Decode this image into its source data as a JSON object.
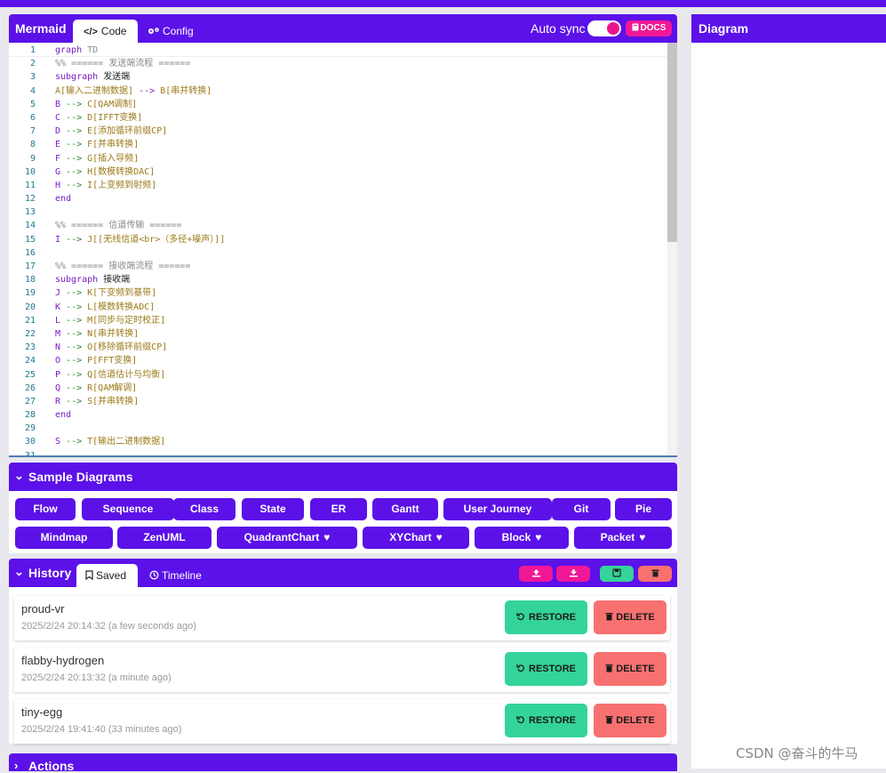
{
  "editor": {
    "title": "Mermaid",
    "tabs": [
      "Code",
      "Config"
    ],
    "code_tab_icon": "</>",
    "config_tab_icon": "gears-icon",
    "auto_sync_label": "Auto sync",
    "auto_sync_enabled": true,
    "docs_label": "DOCS",
    "lines": [
      [
        {
          "t": "graph ",
          "c": "kw"
        },
        {
          "t": "TD",
          "c": "cm"
        }
      ],
      [
        {
          "t": "%% ====== 发送端流程 ======",
          "c": "cm"
        }
      ],
      [
        {
          "t": "subgraph ",
          "c": "kw"
        },
        {
          "t": "发送端",
          "c": "tx"
        }
      ],
      [
        {
          "t": "A[输入二进制数据] ",
          "c": "br"
        },
        {
          "t": "--> ",
          "c": "kw"
        },
        {
          "t": "B[串并转换]",
          "c": "br"
        }
      ],
      [
        {
          "t": "B ",
          "c": "kw"
        },
        {
          "t": "--> ",
          "c": "ar"
        },
        {
          "t": "C[QAM调制]",
          "c": "br"
        }
      ],
      [
        {
          "t": "C ",
          "c": "kw"
        },
        {
          "t": "--> ",
          "c": "ar"
        },
        {
          "t": "D[IFFT变换]",
          "c": "br"
        }
      ],
      [
        {
          "t": "D ",
          "c": "kw"
        },
        {
          "t": "--> ",
          "c": "ar"
        },
        {
          "t": "E[添加循环前缀CP]",
          "c": "br"
        }
      ],
      [
        {
          "t": "E ",
          "c": "kw"
        },
        {
          "t": "--> ",
          "c": "ar"
        },
        {
          "t": "F[并串转换]",
          "c": "br"
        }
      ],
      [
        {
          "t": "F ",
          "c": "kw"
        },
        {
          "t": "--> ",
          "c": "ar"
        },
        {
          "t": "G[插入导频]",
          "c": "br"
        }
      ],
      [
        {
          "t": "G ",
          "c": "kw"
        },
        {
          "t": "--> ",
          "c": "ar"
        },
        {
          "t": "H[数模转换DAC]",
          "c": "br"
        }
      ],
      [
        {
          "t": "H ",
          "c": "kw"
        },
        {
          "t": "--> ",
          "c": "ar"
        },
        {
          "t": "I[上变频到射频]",
          "c": "br"
        }
      ],
      [
        {
          "t": "end",
          "c": "kw"
        }
      ],
      [],
      [
        {
          "t": "%% ====== 信道传输 ======",
          "c": "cm"
        }
      ],
      [
        {
          "t": "I ",
          "c": "kw"
        },
        {
          "t": "--> ",
          "c": "ar"
        },
        {
          "t": "J[[无线信道<br>（多径+噪声）]]",
          "c": "br"
        }
      ],
      [],
      [
        {
          "t": "%% ====== 接收端流程 ======",
          "c": "cm"
        }
      ],
      [
        {
          "t": "subgraph ",
          "c": "kw"
        },
        {
          "t": "接收端",
          "c": "tx"
        }
      ],
      [
        {
          "t": "J ",
          "c": "kw"
        },
        {
          "t": "--> ",
          "c": "ar"
        },
        {
          "t": "K[下变频到基带]",
          "c": "br"
        }
      ],
      [
        {
          "t": "K ",
          "c": "kw"
        },
        {
          "t": "--> ",
          "c": "ar"
        },
        {
          "t": "L[模数转换ADC]",
          "c": "br"
        }
      ],
      [
        {
          "t": "L ",
          "c": "kw"
        },
        {
          "t": "--> ",
          "c": "ar"
        },
        {
          "t": "M[同步与定时校正]",
          "c": "br"
        }
      ],
      [
        {
          "t": "M ",
          "c": "kw"
        },
        {
          "t": "--> ",
          "c": "ar"
        },
        {
          "t": "N[串并转换]",
          "c": "br"
        }
      ],
      [
        {
          "t": "N ",
          "c": "kw"
        },
        {
          "t": "--> ",
          "c": "ar"
        },
        {
          "t": "O[移除循环前缀CP]",
          "c": "br"
        }
      ],
      [
        {
          "t": "O ",
          "c": "kw"
        },
        {
          "t": "--> ",
          "c": "ar"
        },
        {
          "t": "P[FFT变换]",
          "c": "br"
        }
      ],
      [
        {
          "t": "P ",
          "c": "kw"
        },
        {
          "t": "--> ",
          "c": "ar"
        },
        {
          "t": "Q[信道估计与均衡]",
          "c": "br"
        }
      ],
      [
        {
          "t": "Q ",
          "c": "kw"
        },
        {
          "t": "--> ",
          "c": "ar"
        },
        {
          "t": "R[QAM解调]",
          "c": "br"
        }
      ],
      [
        {
          "t": "R ",
          "c": "kw"
        },
        {
          "t": "--> ",
          "c": "ar"
        },
        {
          "t": "S[并串转换]",
          "c": "br"
        }
      ],
      [
        {
          "t": "end",
          "c": "kw"
        }
      ],
      [],
      [
        {
          "t": "S ",
          "c": "kw"
        },
        {
          "t": "--> ",
          "c": "ar"
        },
        {
          "t": "T[输出二进制数据]",
          "c": "br"
        }
      ],
      []
    ]
  },
  "samples": {
    "title": "Sample Diagrams",
    "heart": "♥",
    "row1": [
      "Flow",
      "Sequence",
      "Class",
      "State",
      "ER",
      "Gantt",
      "User Journey",
      "Git",
      "Pie"
    ],
    "row2": [
      "Mindmap",
      "ZenUML",
      "QuadrantChart",
      "XYChart",
      "Block",
      "Packet"
    ],
    "row2_hearts": [
      false,
      false,
      true,
      true,
      true,
      true
    ]
  },
  "history": {
    "title": "History",
    "tabs": [
      "Saved",
      "Timeline"
    ],
    "restore_label": "RESTORE",
    "delete_label": "DELETE",
    "items": [
      {
        "name": "proud-vr",
        "meta": "2025/2/24 20:14:32 (a few seconds ago)"
      },
      {
        "name": "flabby-hydrogen",
        "meta": "2025/2/24 20:13:32 (a minute ago)"
      },
      {
        "name": "tiny-egg",
        "meta": "2025/2/24 19:41:40 (33 minutes ago)"
      }
    ]
  },
  "actions": {
    "title": "Actions"
  },
  "diagram": {
    "title": "Diagram"
  },
  "watermark": "CSDN @奋斗的牛马",
  "colors": {
    "brand": "#5b11e8",
    "pink": "#f01896",
    "restore": "#34d399",
    "delete": "#f87171"
  }
}
